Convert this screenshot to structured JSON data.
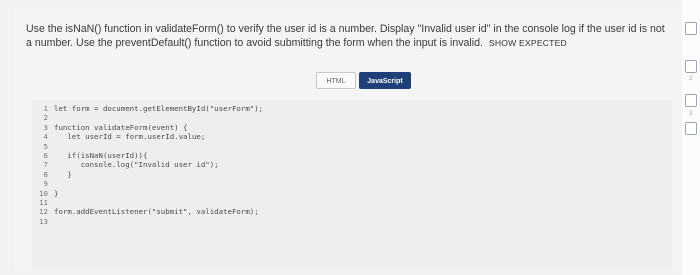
{
  "question": {
    "text": "Use the isNaN() function in validateForm() to verify the user id is a number. Display \"Invalid user id\" in the console log if the user id is not a number. Use the preventDefault() function to avoid submitting the form when the input is invalid.",
    "show_expected": "SHOW EXPECTED"
  },
  "tabs": {
    "html": "HTML",
    "javascript": "JavaScript"
  },
  "code_lines": [
    {
      "num": "1",
      "text": "let form = document.getElementById(\"userForm\");"
    },
    {
      "num": "2",
      "text": ""
    },
    {
      "num": "3",
      "text": "function validateForm(event) {"
    },
    {
      "num": "4",
      "text": "   let userId = form.userId.value;"
    },
    {
      "num": "5",
      "text": ""
    },
    {
      "num": "6",
      "text": "   if(isNaN(userId)){"
    },
    {
      "num": "7",
      "text": "      console.log(\"Invalid user id\");"
    },
    {
      "num": "8",
      "text": "   }"
    },
    {
      "num": "9",
      "text": ""
    },
    {
      "num": "10",
      "text": "}"
    },
    {
      "num": "11",
      "text": ""
    },
    {
      "num": "12",
      "text": "form.addEventListener(\"submit\", validateForm);"
    },
    {
      "num": "13",
      "text": ""
    }
  ],
  "side_numbers": [
    "1",
    "2",
    "3"
  ]
}
